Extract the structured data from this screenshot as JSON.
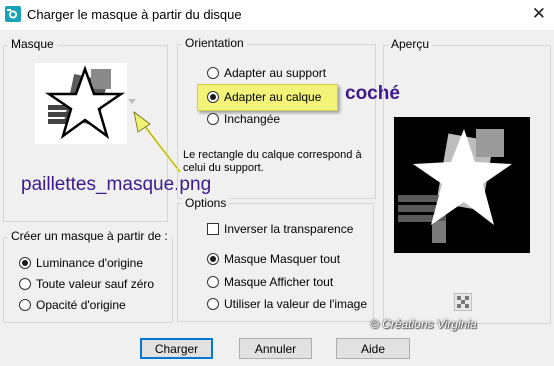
{
  "window": {
    "title": "Charger le masque à partir du disque"
  },
  "mask_group": {
    "label": "Masque",
    "mask_file": "paillettes_masque.png"
  },
  "create_group": {
    "label": "Créer un masque à partir de :",
    "options": [
      {
        "label": "Luminance d'origine",
        "checked": true
      },
      {
        "label": "Toute valeur sauf zéro",
        "checked": false
      },
      {
        "label": "Opacité d'origine",
        "checked": false
      }
    ]
  },
  "orientation_group": {
    "label": "Orientation",
    "options": [
      {
        "label": "Adapter au support",
        "checked": false
      },
      {
        "label": "Adapter au calque",
        "checked": true
      },
      {
        "label": "Inchangée",
        "checked": false
      }
    ],
    "info": "Le rectangle du calque correspond à celui du support."
  },
  "annotation": {
    "checked_note": "coché"
  },
  "options_group": {
    "label": "Options",
    "invert": {
      "label": "Inverser la transparence",
      "checked": false
    },
    "radios": [
      {
        "label": "Masque Masquer tout",
        "checked": true
      },
      {
        "label": "Masque Afficher tout",
        "checked": false
      },
      {
        "label": "Utiliser la valeur de l'image",
        "checked": false
      }
    ]
  },
  "preview_group": {
    "label": "Aperçu"
  },
  "watermark": "© Créations Virginia",
  "buttons": {
    "load": "Charger",
    "cancel": "Annuler",
    "help": "Aide"
  },
  "colors": {
    "annotation_text": "#3c1a8c",
    "highlight": "#f3f37a",
    "arrow": "#f0f070",
    "default_button_border": "#0078d7"
  }
}
